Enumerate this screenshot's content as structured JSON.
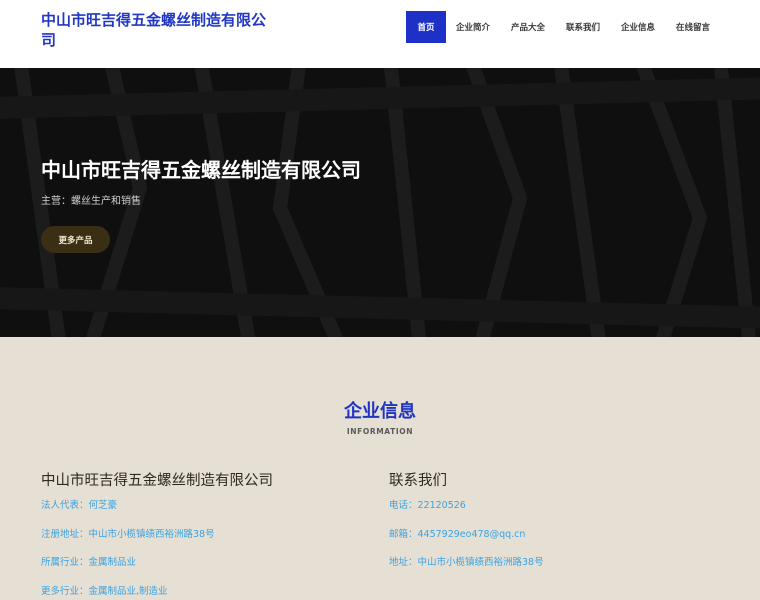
{
  "header": {
    "site_title": "中山市旺吉得五金螺丝制造有限公司",
    "nav": [
      {
        "label": "首页",
        "active": true
      },
      {
        "label": "企业简介",
        "active": false
      },
      {
        "label": "产品大全",
        "active": false
      },
      {
        "label": "联系我们",
        "active": false
      },
      {
        "label": "企业信息",
        "active": false
      },
      {
        "label": "在线留言",
        "active": false
      }
    ]
  },
  "hero": {
    "title": "中山市旺吉得五金螺丝制造有限公司",
    "subtitle": "主营：螺丝生产和销售",
    "button_label": "更多产品"
  },
  "info": {
    "title": "企业信息",
    "subtitle": "INFORMATION",
    "left": {
      "heading": "中山市旺吉得五金螺丝制造有限公司",
      "rows": [
        "法人代表：何芝豪",
        "注册地址：中山市小榄镇绩西裕洲路38号",
        "所属行业：金属制品业",
        "更多行业：金属制品业,制造业"
      ]
    },
    "right": {
      "heading": "联系我们",
      "rows": [
        "电话：22120526",
        "邮箱：4457929eo478@qq.cn",
        "地址：中山市小榄镇绩西裕洲路38号"
      ]
    }
  },
  "colors": {
    "accent": "#1d31c7",
    "link": "#3aa3e0",
    "section_bg": "#e6dfd4",
    "hero_bg": "#141414",
    "button_bg": "#3a2f14"
  }
}
